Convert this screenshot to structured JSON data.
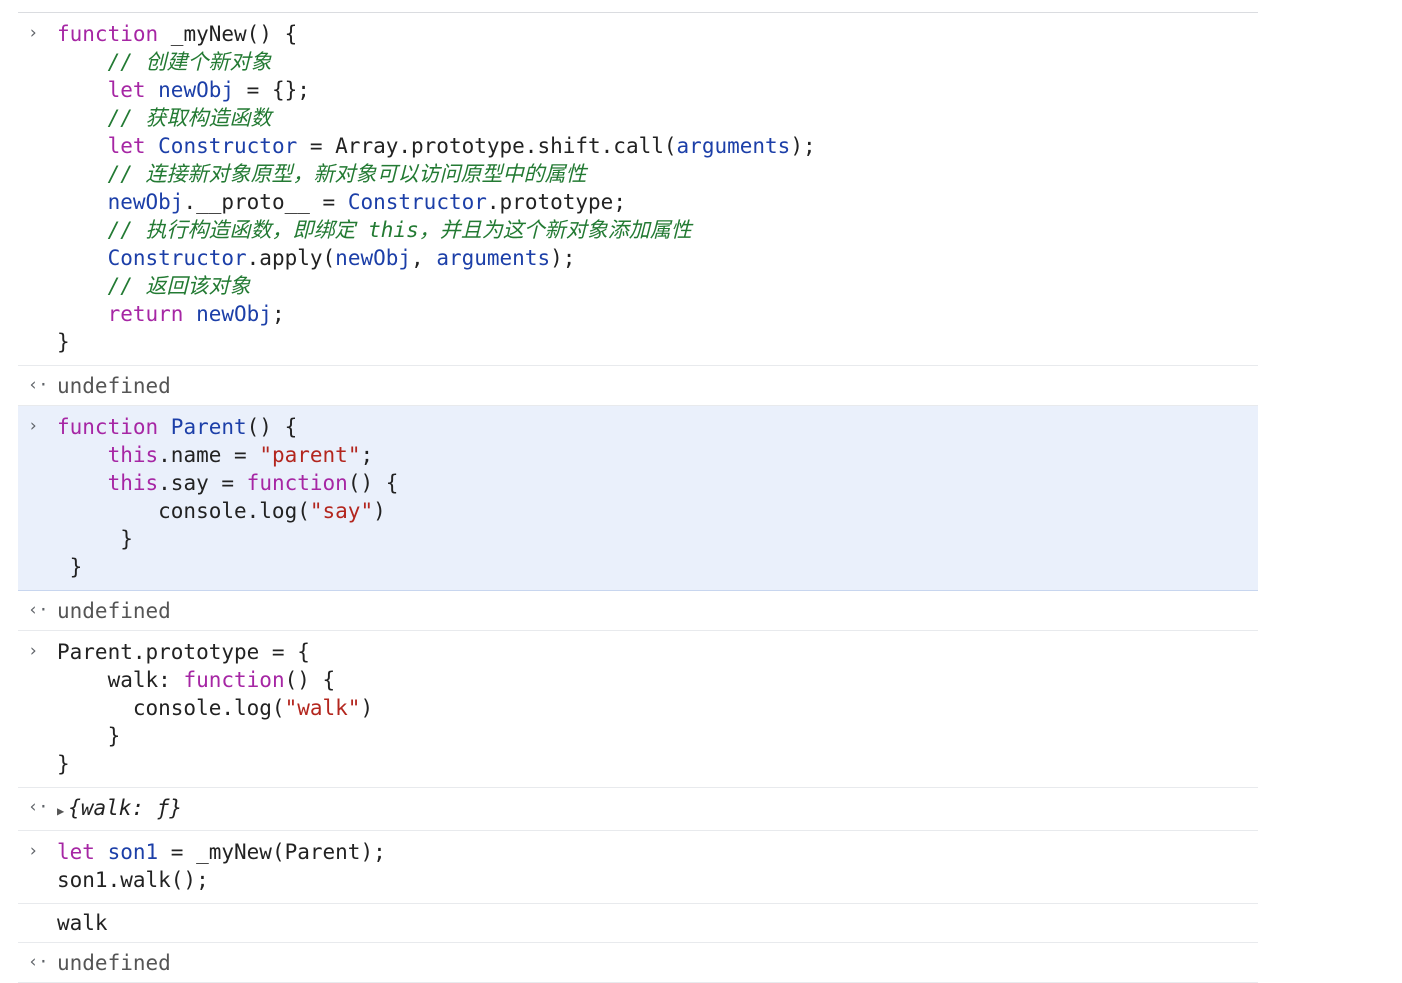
{
  "console": {
    "entries": [
      {
        "kind": "input",
        "highlighted": false,
        "prompt": "›",
        "lines": [
          [
            {
              "t": "function ",
              "c": "kw"
            },
            {
              "t": "_myNew",
              "c": "pun"
            },
            {
              "t": "() {",
              "c": "pun"
            }
          ],
          [
            {
              "t": "    ",
              "c": "pun"
            },
            {
              "t": "// 创建个新对象",
              "c": "cmt"
            }
          ],
          [
            {
              "t": "    ",
              "c": "pun"
            },
            {
              "t": "let ",
              "c": "kw"
            },
            {
              "t": "newObj",
              "c": "var"
            },
            {
              "t": " = {};",
              "c": "pun"
            }
          ],
          [
            {
              "t": "    ",
              "c": "pun"
            },
            {
              "t": "// 获取构造函数",
              "c": "cmt"
            }
          ],
          [
            {
              "t": "    ",
              "c": "pun"
            },
            {
              "t": "let ",
              "c": "kw"
            },
            {
              "t": "Constructor",
              "c": "var"
            },
            {
              "t": " = Array.prototype.shift.call(",
              "c": "pun"
            },
            {
              "t": "arguments",
              "c": "arg"
            },
            {
              "t": ");",
              "c": "pun"
            }
          ],
          [
            {
              "t": "    ",
              "c": "pun"
            },
            {
              "t": "// 连接新对象原型，新对象可以访问原型中的属性",
              "c": "cmt"
            }
          ],
          [
            {
              "t": "    ",
              "c": "pun"
            },
            {
              "t": "newObj",
              "c": "var"
            },
            {
              "t": ".__proto__ = ",
              "c": "pun"
            },
            {
              "t": "Constructor",
              "c": "var"
            },
            {
              "t": ".prototype;",
              "c": "pun"
            }
          ],
          [
            {
              "t": "    ",
              "c": "pun"
            },
            {
              "t": "// 执行构造函数，即绑定 this，并且为这个新对象添加属性",
              "c": "cmt"
            }
          ],
          [
            {
              "t": "    ",
              "c": "pun"
            },
            {
              "t": "Constructor",
              "c": "var"
            },
            {
              "t": ".apply(",
              "c": "pun"
            },
            {
              "t": "newObj",
              "c": "var"
            },
            {
              "t": ", ",
              "c": "pun"
            },
            {
              "t": "arguments",
              "c": "arg"
            },
            {
              "t": ");",
              "c": "pun"
            }
          ],
          [
            {
              "t": "    ",
              "c": "pun"
            },
            {
              "t": "// 返回该对象",
              "c": "cmt"
            }
          ],
          [
            {
              "t": "    ",
              "c": "pun"
            },
            {
              "t": "return ",
              "c": "kw"
            },
            {
              "t": "newObj",
              "c": "var"
            },
            {
              "t": ";",
              "c": "pun"
            }
          ],
          [
            {
              "t": "}",
              "c": "pun"
            }
          ]
        ]
      },
      {
        "kind": "result",
        "prompt": "‹·",
        "lines": [
          [
            {
              "t": "undefined",
              "c": "out"
            }
          ]
        ]
      },
      {
        "kind": "input",
        "highlighted": true,
        "prompt": "›",
        "lines": [
          [
            {
              "t": "function ",
              "c": "kw"
            },
            {
              "t": "Parent",
              "c": "var"
            },
            {
              "t": "() {",
              "c": "pun"
            }
          ],
          [
            {
              "t": "    ",
              "c": "pun"
            },
            {
              "t": "this",
              "c": "kw"
            },
            {
              "t": ".name = ",
              "c": "pun"
            },
            {
              "t": "\"parent\"",
              "c": "str"
            },
            {
              "t": ";",
              "c": "pun"
            }
          ],
          [
            {
              "t": "    ",
              "c": "pun"
            },
            {
              "t": "this",
              "c": "kw"
            },
            {
              "t": ".say = ",
              "c": "pun"
            },
            {
              "t": "function",
              "c": "kw"
            },
            {
              "t": "() {",
              "c": "pun"
            }
          ],
          [
            {
              "t": "        console.log(",
              "c": "pun"
            },
            {
              "t": "\"say\"",
              "c": "str"
            },
            {
              "t": ")",
              "c": "pun"
            }
          ],
          [
            {
              "t": "     }",
              "c": "pun"
            }
          ],
          [
            {
              "t": " }",
              "c": "pun"
            }
          ]
        ]
      },
      {
        "kind": "result",
        "prompt": "‹·",
        "lines": [
          [
            {
              "t": "undefined",
              "c": "out"
            }
          ]
        ]
      },
      {
        "kind": "input",
        "highlighted": false,
        "prompt": "›",
        "lines": [
          [
            {
              "t": "Parent.prototype = {",
              "c": "pun"
            }
          ],
          [
            {
              "t": "    walk: ",
              "c": "pun"
            },
            {
              "t": "function",
              "c": "kw"
            },
            {
              "t": "() {",
              "c": "pun"
            }
          ],
          [
            {
              "t": "      console.log(",
              "c": "pun"
            },
            {
              "t": "\"walk\"",
              "c": "str"
            },
            {
              "t": ")",
              "c": "pun"
            }
          ],
          [
            {
              "t": "    }",
              "c": "pun"
            }
          ],
          [
            {
              "t": "}",
              "c": "pun"
            }
          ]
        ]
      },
      {
        "kind": "result",
        "prompt": "‹·",
        "lines": [
          [
            {
              "t": "▶",
              "c": "caret"
            },
            {
              "t": "{walk: ƒ}",
              "c": "obj"
            }
          ]
        ]
      },
      {
        "kind": "input",
        "highlighted": false,
        "prompt": "›",
        "lines": [
          [
            {
              "t": "let ",
              "c": "kw"
            },
            {
              "t": "son1",
              "c": "var"
            },
            {
              "t": " = _myNew(Parent);",
              "c": "pun"
            }
          ],
          [
            {
              "t": "son1.walk();",
              "c": "pun"
            }
          ]
        ]
      },
      {
        "kind": "log",
        "prompt": "",
        "lines": [
          [
            {
              "t": "walk",
              "c": "pun"
            }
          ]
        ]
      },
      {
        "kind": "result",
        "prompt": "‹·",
        "lines": [
          [
            {
              "t": "undefined",
              "c": "out"
            }
          ]
        ]
      }
    ]
  }
}
